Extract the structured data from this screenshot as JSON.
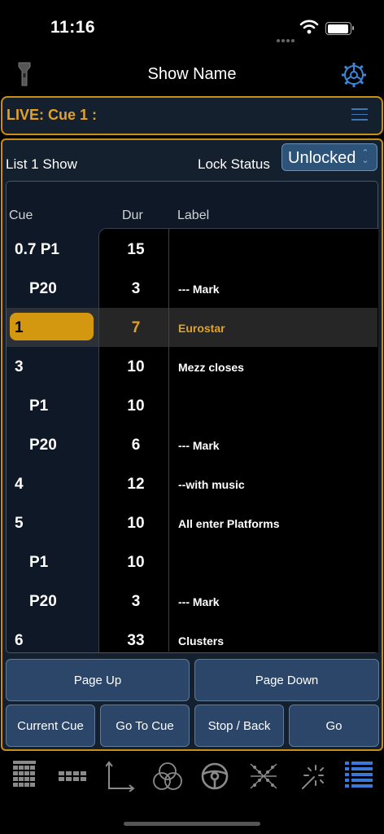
{
  "status_bar": {
    "time": "11:16"
  },
  "header": {
    "title": "Show Name"
  },
  "live": {
    "label": "LIVE: Cue  1 :"
  },
  "list": {
    "title": "List 1 Show",
    "lock_label": "Lock Status",
    "lock_value": "Unlocked"
  },
  "table": {
    "headers": {
      "cue": "Cue",
      "dur": "Dur",
      "label": "Label"
    },
    "rows": [
      {
        "cue": "0.7 P1",
        "dur": "15",
        "label": ""
      },
      {
        "cue": "P20",
        "dur": "3",
        "label": "--- Mark"
      },
      {
        "cue": "1",
        "dur": "7",
        "label": "Eurostar"
      },
      {
        "cue": "3",
        "dur": "10",
        "label": "Mezz closes"
      },
      {
        "cue": "P1",
        "dur": "10",
        "label": ""
      },
      {
        "cue": "P20",
        "dur": "6",
        "label": "--- Mark"
      },
      {
        "cue": "4",
        "dur": "12",
        "label": "--with music"
      },
      {
        "cue": "5",
        "dur": "10",
        "label": "All enter Platforms"
      },
      {
        "cue": "P1",
        "dur": "10",
        "label": ""
      },
      {
        "cue": "P20",
        "dur": "3",
        "label": "--- Mark"
      },
      {
        "cue": "6",
        "dur": "33",
        "label": "Clusters"
      }
    ]
  },
  "buttons": {
    "page_up": "Page Up",
    "page_down": "Page Down",
    "current_cue": "Current Cue",
    "go_to_cue": "Go To Cue",
    "stop_back": "Stop / Back",
    "go": "Go"
  },
  "tabs": [
    {
      "icon": "channel-grid-icon"
    },
    {
      "icon": "fixture-grid-icon"
    },
    {
      "icon": "axis-icon"
    },
    {
      "icon": "color-mix-icon"
    },
    {
      "icon": "steering-wheel-icon"
    },
    {
      "icon": "crossfade-icon"
    },
    {
      "icon": "effects-wand-icon"
    },
    {
      "icon": "cue-list-icon",
      "active": true
    }
  ],
  "colors": {
    "accent": "#d39710",
    "panel": "#15202e",
    "button": "#2b4668",
    "tab_active": "#3b78d8"
  }
}
